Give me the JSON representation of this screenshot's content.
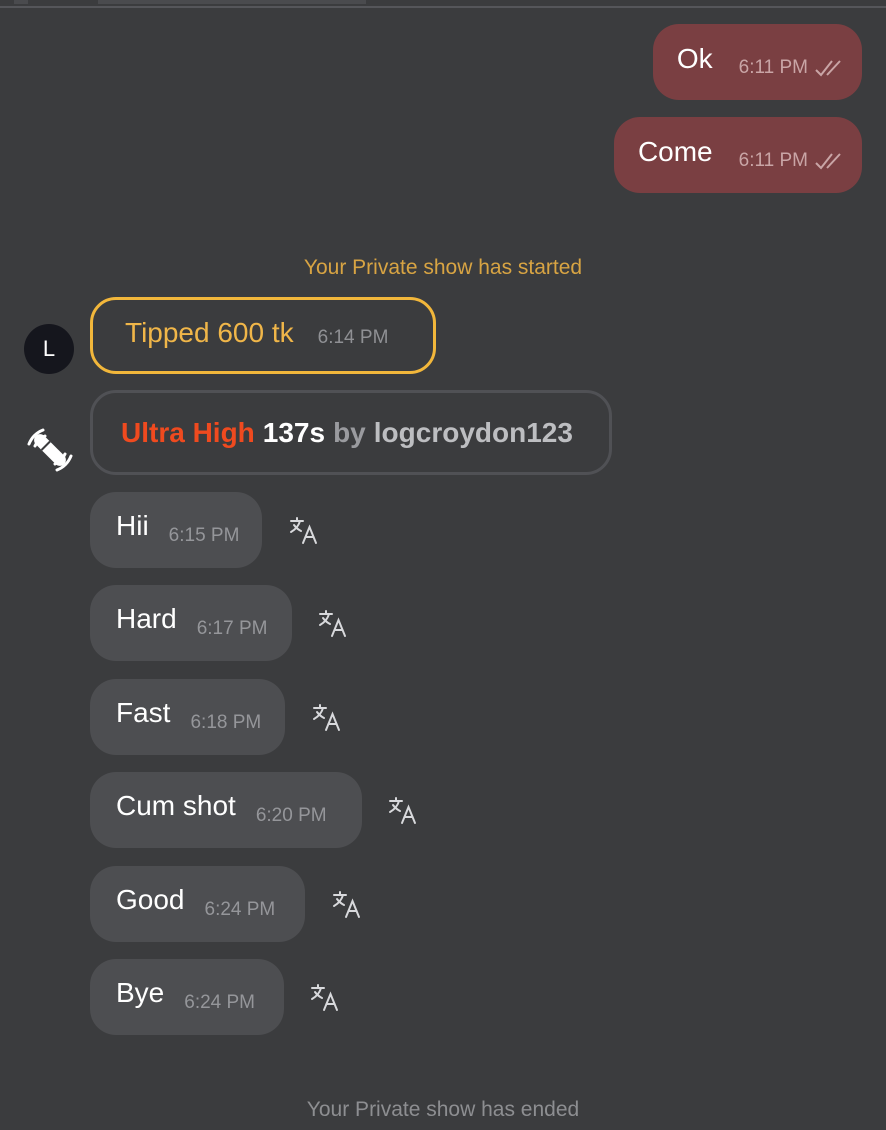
{
  "outgoing": [
    {
      "text": "Ok",
      "time": "6:11 PM"
    },
    {
      "text": "Come",
      "time": "6:11 PM"
    }
  ],
  "system": {
    "started": "Your Private show has started",
    "ended": "Your Private show has ended"
  },
  "avatar": {
    "initial": "L"
  },
  "tip": {
    "text": "Tipped 600 tk",
    "time": "6:14 PM"
  },
  "toy": {
    "level": "Ultra High",
    "duration": "137s",
    "by": "by",
    "user": "logcroydon123",
    "icon": "vibrate-toy-icon"
  },
  "incoming": [
    {
      "text": "Hii",
      "time": "6:15 PM"
    },
    {
      "text": "Hard",
      "time": "6:17 PM"
    },
    {
      "text": "Fast",
      "time": "6:18 PM"
    },
    {
      "text": "Cum shot",
      "time": "6:20 PM"
    },
    {
      "text": "Good",
      "time": "6:24 PM"
    },
    {
      "text": "Bye",
      "time": "6:24 PM"
    }
  ],
  "colors": {
    "background": "#3b3c3e",
    "outgoing_bubble": "#7a3f42",
    "incoming_bubble": "#4d4e51",
    "tip_accent": "#f2b73b",
    "toy_level": "#ef4a1f"
  }
}
